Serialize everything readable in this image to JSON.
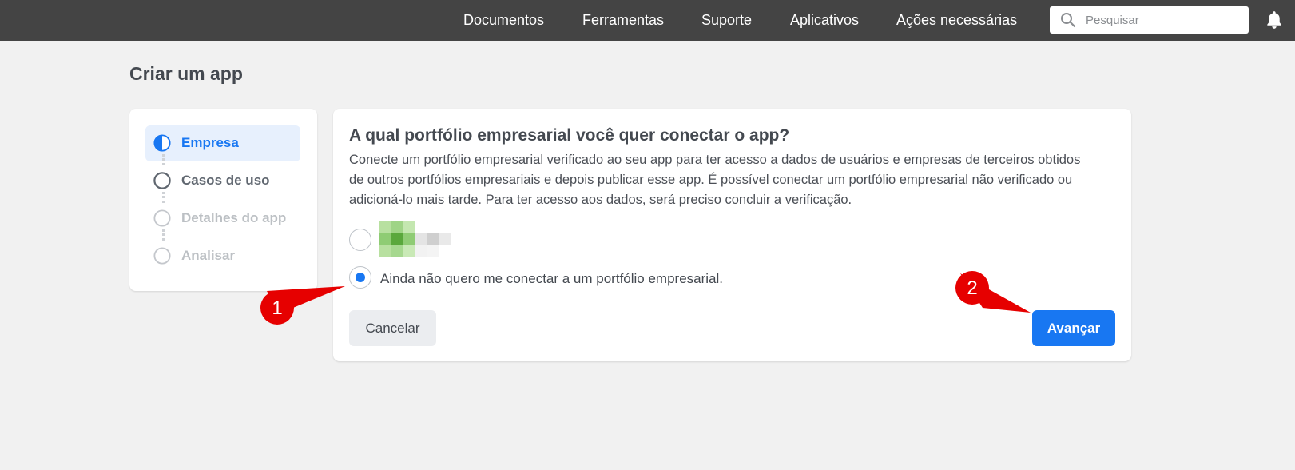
{
  "nav": {
    "items": [
      "Documentos",
      "Ferramentas",
      "Suporte",
      "Aplicativos",
      "Ações necessárias"
    ],
    "search_placeholder": "Pesquisar"
  },
  "page": {
    "title": "Criar um app"
  },
  "steps": [
    {
      "label": "Empresa",
      "state": "active"
    },
    {
      "label": "Casos de uso",
      "state": "pending"
    },
    {
      "label": "Detalhes do app",
      "state": "disabled"
    },
    {
      "label": "Analisar",
      "state": "disabled"
    }
  ],
  "main": {
    "question": "A qual portfólio empresarial você quer conectar o app?",
    "description": "Conecte um portfólio empresarial verificado ao seu app para ter acesso a dados de usuários e empresas de terceiros obtidos de outros portfólios empresariais e depois publicar esse app. É possível conectar um portfólio empresarial não verificado ou adicioná-lo mais tarde. Para ter acesso aos dados, será preciso concluir a verificação.",
    "option_none_label": "Ainda não quero me conectar a um portfólio empresarial.",
    "selected_option": "none",
    "cancel_label": "Cancelar",
    "next_label": "Avançar"
  },
  "annotations": {
    "marker1": "1",
    "marker2": "2"
  },
  "colors": {
    "topbar": "#444444",
    "accent": "#1877f2",
    "active_step_bg": "#e7f0fd",
    "marker": "#e60000"
  }
}
